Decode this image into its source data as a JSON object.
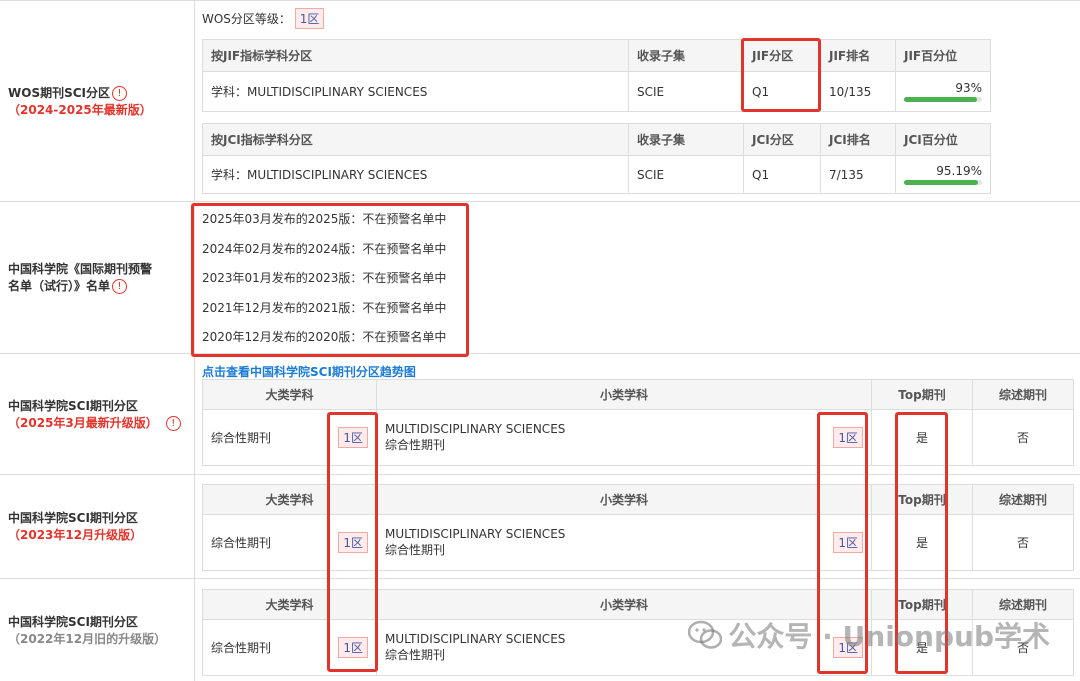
{
  "wos": {
    "label": "WOS期刊SCI分区",
    "sub": "（2024-2025年最新版）",
    "level_label": "WOS分区等级：",
    "level_value": "1区",
    "jif_table": {
      "headers": [
        "按JIF指标学科分区",
        "收录子集",
        "JIF分区",
        "JIF排名",
        "JIF百分位"
      ],
      "row": {
        "subject": "学科：MULTIDISCIPLINARY SCIENCES",
        "subset": "SCIE",
        "quartile": "Q1",
        "rank": "10/135",
        "percentile": "93%",
        "percentile_value": 93
      }
    },
    "jci_table": {
      "headers": [
        "按JCI指标学科分区",
        "收录子集",
        "JCI分区",
        "JCI排名",
        "JCI百分位"
      ],
      "row": {
        "subject": "学科：MULTIDISCIPLINARY SCIENCES",
        "subset": "SCIE",
        "quartile": "Q1",
        "rank": "7/135",
        "percentile": "95.19%",
        "percentile_value": 95.19
      }
    }
  },
  "warning": {
    "label_line1": "中国科学院《国际期刊预警",
    "label_line2": "名单（试行）》名单",
    "items": [
      "2025年03月发布的2025版：不在预警名单中",
      "2024年02月发布的2024版：不在预警名单中",
      "2023年01月发布的2023版：不在预警名单中",
      "2021年12月发布的2021版：不在预警名单中",
      "2020年12月发布的2020版：不在预警名单中"
    ]
  },
  "cas_link": "点击查看中国科学院SCI期刊分区趋势图",
  "cas_headers": [
    "大类学科",
    "小类学科",
    "Top期刊",
    "综述期刊"
  ],
  "cas_sections": [
    {
      "label": "中国科学院SCI期刊分区",
      "sub": "（2025年3月最新升级版）",
      "major": "综合性期刊",
      "major_zone": "1区",
      "minor_en": "MULTIDISCIPLINARY SCIENCES",
      "minor_cn": "综合性期刊",
      "minor_zone": "1区",
      "top": "是",
      "review": "否"
    },
    {
      "label": "中国科学院SCI期刊分区",
      "sub": "（2023年12月升级版）",
      "major": "综合性期刊",
      "major_zone": "1区",
      "minor_en": "MULTIDISCIPLINARY SCIENCES",
      "minor_cn": "综合性期刊",
      "minor_zone": "1区",
      "top": "是",
      "review": "否"
    },
    {
      "label": "中国科学院SCI期刊分区",
      "sub": "（2022年12月旧的升级版）",
      "major": "综合性期刊",
      "major_zone": "1区",
      "minor_en": "MULTIDISCIPLINARY SCIENCES",
      "minor_cn": "综合性期刊",
      "minor_zone": "1区",
      "top": "是",
      "review": "否"
    }
  ],
  "watermark": "公众号 · Unionpub学术",
  "icons": {
    "info": "info-circle-icon",
    "wechat": "wechat-icon"
  }
}
